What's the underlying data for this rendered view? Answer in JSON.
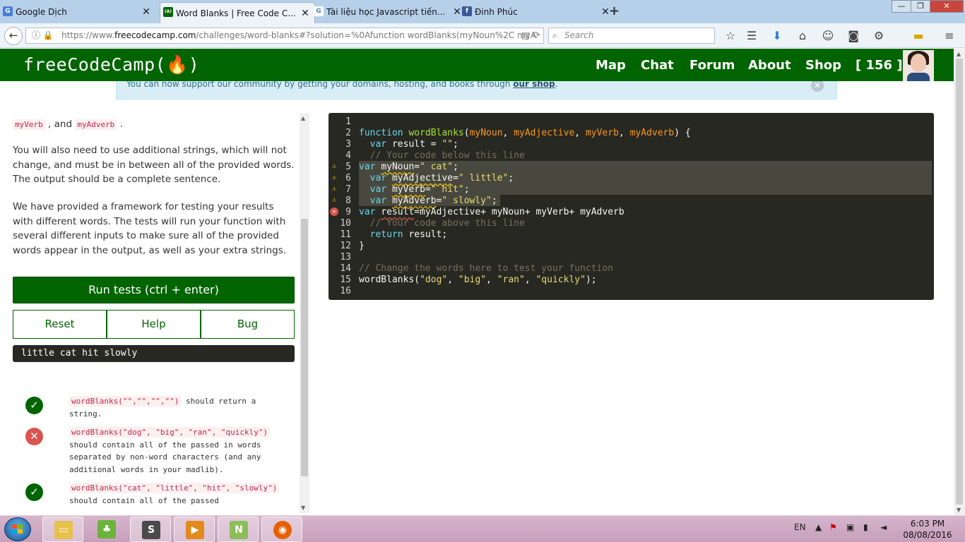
{
  "browser": {
    "tabs": [
      {
        "title": "Google Dịch",
        "favicon": "google-translate-icon",
        "color": "#4a7fd6",
        "glyph": "G"
      },
      {
        "title": "Word Blanks | Free Code C...",
        "favicon": "freecodecamp-icon",
        "color": "#006400",
        "glyph": "(A)"
      },
      {
        "title": "Tài liệu học Javascript tiến...",
        "favicon": "google-icon",
        "color": "#ffffff",
        "glyph": "G"
      },
      {
        "title": "Đinh Phúc",
        "favicon": "facebook-icon",
        "color": "#3b5998",
        "glyph": "f"
      }
    ],
    "url_prefix": "https://www.",
    "url_domain": "freecodecamp.com",
    "url_rest": "/challenges/word-blanks#?solution=%0Afunction wordBlanks(myNoun%2C myA",
    "search_placeholder": "Search"
  },
  "header": {
    "logo": "freeCodeCamp(🔥)",
    "menu": [
      "Map",
      "Chat",
      "Forum",
      "About",
      "Shop"
    ],
    "points": "[ 156 ]"
  },
  "notice": {
    "text": "You can now support our community by getting your domains, hosting, and books through ",
    "link": "our shop",
    "end": "."
  },
  "instructions": {
    "line_top_a": "myVerb",
    "line_top_and": " , and ",
    "line_top_b": "myAdverb",
    "line_top_end": " .",
    "para1": "You will also need to use additional strings, which will not change, and must be in between all of the provided words. The output should be a complete sentence.",
    "para2": "We have provided a framework for testing your results with different words. The tests will run your function with several different inputs to make sure all of the provided words appear in the output, as well as your extra strings."
  },
  "buttons": {
    "run": "Run tests (ctrl + enter)",
    "reset": "Reset",
    "help": "Help",
    "bug": "Bug"
  },
  "output": "little cat hit slowly",
  "tests": [
    {
      "status": "pass",
      "code": "wordBlanks(\"\",\"\",\"\",\"\")",
      "text": " should return a string."
    },
    {
      "status": "fail",
      "code": "wordBlanks(\"dog\", \"big\", \"ran\", \"quickly\")",
      "text": " should contain all of the passed in words separated by non-word characters (and any additional words in your madlib)."
    },
    {
      "status": "pass",
      "code": "wordBlanks(\"cat\", \"little\", \"hit\", \"slowly\")",
      "text": " should contain all of the passed"
    }
  ],
  "editor": {
    "line_numbers": [
      "1",
      "2",
      "3",
      "4",
      "5",
      "6",
      "7",
      "8",
      "9",
      "10",
      "11",
      "12",
      "13",
      "14",
      "15",
      "16"
    ]
  },
  "taskbar": {
    "language": "EN",
    "time": "6:03 PM",
    "date": "08/08/2016"
  },
  "colors": {
    "fcc_green": "#006400",
    "editor_bg": "#272822",
    "fail_red": "#d9534f"
  }
}
